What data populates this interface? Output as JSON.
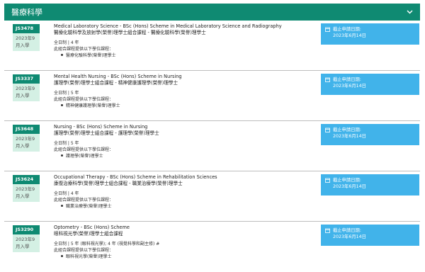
{
  "header": {
    "title": "醫療科學"
  },
  "programs": [
    {
      "code": "JS3478",
      "intake": "2023年9月入學",
      "title_en": "Medical Laboratory Science - BSc (Hons) Scheme in Medical Laboratory Science and Radiography",
      "title_zh": "醫療化驗科學及放射學(榮譽)理學士組合課程 - 醫療化驗科學(榮譽)理學士",
      "mode": "全日制 | 4 年",
      "offer_note": "此組合課程提供以下學位課程：",
      "awards": [
        "醫療化驗科學(榮譽)理學士"
      ],
      "deadline_label": "截止申請日期:",
      "deadline_date": "2023年6月14日"
    },
    {
      "code": "JS3337",
      "intake": "2023年9月入學",
      "title_en": "Mental Health Nursing - BSc (Hons) Scheme in Nursing",
      "title_zh": "護理學(榮譽)理學士組合課程 - 精神健康護理學(榮譽)理學士",
      "mode": "全日制 | 5 年",
      "offer_note": "此組合課程提供以下學位課程：",
      "awards": [
        "精神健康護理學(榮譽)理學士"
      ],
      "deadline_label": "截止申請日期:",
      "deadline_date": "2023年6月14日"
    },
    {
      "code": "JS3648",
      "intake": "2023年9月入學",
      "title_en": "Nursing - BSc (Hons) Scheme in Nursing",
      "title_zh": "護理學(榮譽)理學士組合課程 - 護理學(榮譽)理學士",
      "mode": "全日制 | 5 年",
      "offer_note": "此組合課程提供以下學位課程：",
      "awards": [
        "護理學(榮譽)理學士"
      ],
      "deadline_label": "截止申請日期:",
      "deadline_date": "2023年6月14日"
    },
    {
      "code": "JS3624",
      "intake": "2023年9月入學",
      "title_en": "Occupational Therapy - BSc (Hons) Scheme in Rehabilitation Sciences",
      "title_zh": "康復治療科學(榮譽)理學士組合課程 - 職業治療學(榮譽)理學士",
      "mode": "全日制 | 4 年",
      "offer_note": "此組合課程提供以下學位課程：",
      "awards": [
        "職業治療學(榮譽)理學士"
      ],
      "deadline_label": "截止申請日期:",
      "deadline_date": "2023年6月14日"
    },
    {
      "code": "JS3290",
      "intake": "2023年9月入學",
      "title_en": "Optometry - BSc (Hons) Scheme",
      "title_zh": "眼科視光學(榮譽)理學士組合課程",
      "mode": "全日制 | 5 年 (眼科視光學); 4 年 (視覺科學和副主修) #",
      "offer_note": "此組合課程提供以下學位課程：",
      "awards": [
        "眼科視光學(榮譽)理學士"
      ],
      "deadline_label": "截止申請日期:",
      "deadline_date": "2023年6月14日"
    }
  ],
  "colors": {
    "header": "#0f8a72",
    "badge": "#0f8a72",
    "intake_bg": "#d4f0e4",
    "deadline_bg": "#41b3ea"
  },
  "icons": {
    "header_toggle": "chevron-down-icon",
    "deadline": "calendar-icon"
  }
}
